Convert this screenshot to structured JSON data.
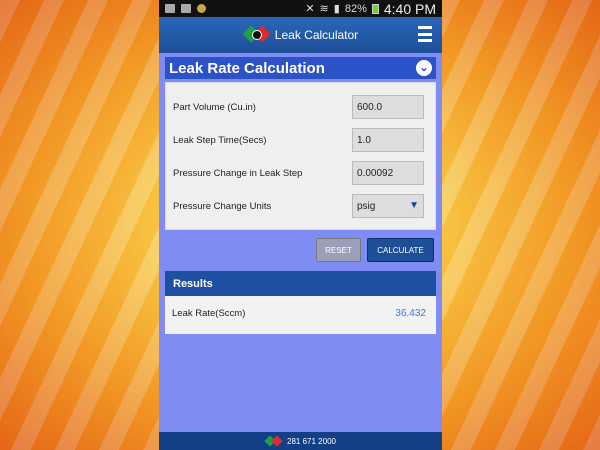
{
  "status_bar": {
    "battery": "82%",
    "time": "4:40 PM"
  },
  "app": {
    "title": "Leak Calculator"
  },
  "section": {
    "title": "Leak Rate Calculation"
  },
  "form": {
    "fields": [
      {
        "label": "Part Volume (Cu.in)",
        "value": "600.0"
      },
      {
        "label": "Leak Step Time(Secs)",
        "value": "1.0"
      },
      {
        "label": "Pressure Change in Leak Step",
        "value": "0.00092"
      },
      {
        "label": "Pressure Change Units",
        "value": "psig"
      }
    ]
  },
  "buttons": {
    "reset": "RESET",
    "calculate": "CALCULATE"
  },
  "results": {
    "title": "Results",
    "label": "Leak Rate(Sccm)",
    "value": "36.432"
  },
  "footer": {
    "phone": "281 671 2000"
  },
  "colors": {
    "accent": "#1d4f99",
    "background": "#7f8cf4",
    "result_value": "#3c7cd0"
  }
}
